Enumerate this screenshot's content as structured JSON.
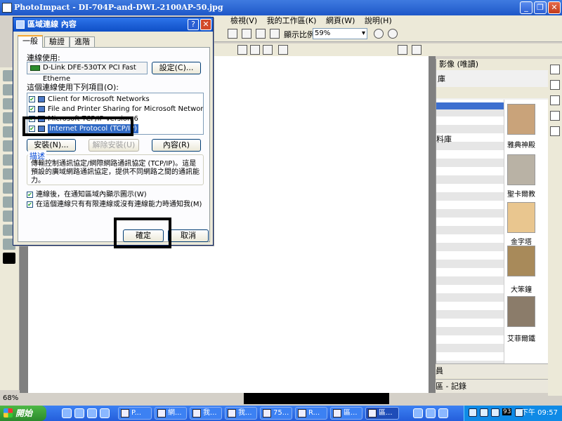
{
  "app": {
    "title": "PhotoImpact - DI-704P-and-DWL-2100AP-50.jpg",
    "menu": [
      "檢視(V)",
      "我的工作區(K)",
      "網頁(W)",
      "說明(H)"
    ],
    "zoom_label": "顯示比例",
    "zoom_value": "59%",
    "status_zoom": "68%"
  },
  "right_panel": {
    "header": "影像 (唯讀)",
    "tab": "庫",
    "list_label": "料庫",
    "thumbs": [
      "雅典神殿",
      "聖卡爾教",
      "金字塔",
      "大笨鐘",
      "艾菲爾鐵"
    ],
    "bottom1": "員",
    "bottom2": "區 - 記錄"
  },
  "dialog": {
    "title": "區域連線 內容",
    "tabs": [
      "一般",
      "驗證",
      "進階"
    ],
    "connect_using_label": "連線使用:",
    "adapter": "D-Link DFE-530TX PCI Fast Etherne",
    "configure_button": "設定(C)...",
    "items_label": "這個連線使用下列項目(O):",
    "items": [
      {
        "label": "Client for Microsoft Networks",
        "checked": true
      },
      {
        "label": "File and Printer Sharing for Microsoft Networks",
        "checked": true
      },
      {
        "label": "Microsoft TCP/IP version 6",
        "checked": true
      },
      {
        "label": "Internet Protocol (TCP/IP)",
        "checked": true
      }
    ],
    "install_button": "安裝(N)...",
    "uninstall_button": "解除安裝(U)",
    "properties_button": "內容(R)",
    "description_legend": "描述",
    "description_text": "傳輸控制通訊協定/網際網路通訊協定 (TCP/IP)。這是預設的廣域網路通訊協定，提供不同網路之間的通訊能力。",
    "show_icon_checkbox": "連線後，在通知區域內顯示圖示(W)",
    "notify_checkbox": "在這個連線只有有限連線或沒有連線能力時通知我(M)",
    "ok_button": "確定",
    "cancel_button": "取消"
  },
  "taskbar": {
    "start": "開始",
    "tasks": [
      "P...",
      "網...",
      "我...",
      "我...",
      "75...",
      "R...",
      "區...",
      "區..."
    ],
    "tray_number": "93",
    "clock": "下午 09:57"
  }
}
